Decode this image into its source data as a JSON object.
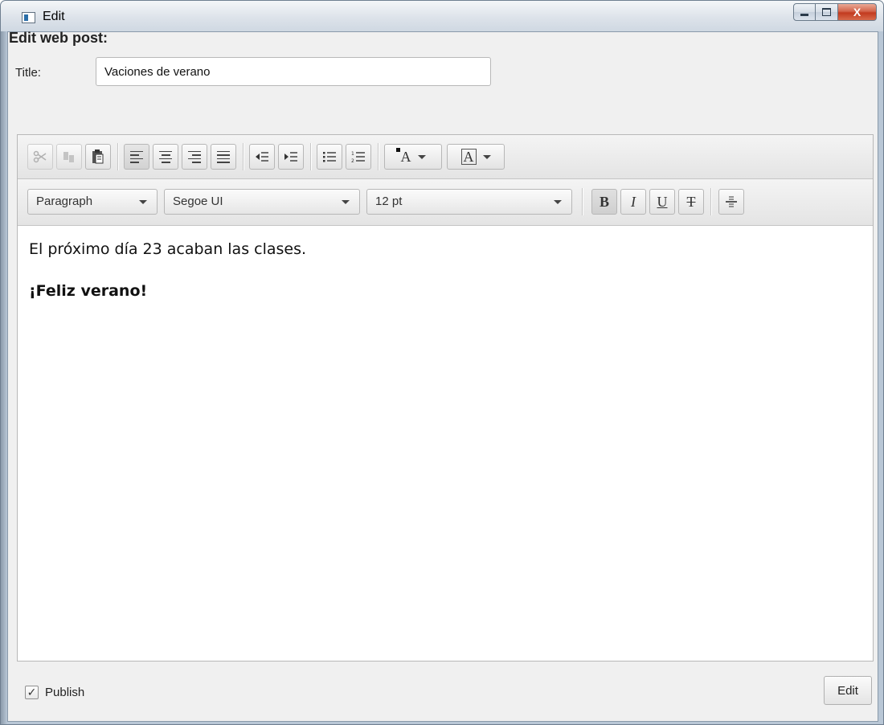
{
  "window": {
    "title": "Edit",
    "close_glyph": "X"
  },
  "form": {
    "heading": "Edit web post:",
    "title_label": "Title:",
    "title_value": "Vaciones de verano"
  },
  "toolbar": {
    "row1_icons": [
      "cut-icon",
      "copy-icon",
      "paste-icon",
      "align-left-icon",
      "align-center-icon",
      "align-right-icon",
      "align-justify-icon",
      "outdent-icon",
      "indent-icon",
      "bullet-list-icon",
      "numbered-list-icon",
      "text-color-icon",
      "background-color-icon"
    ],
    "format_select": "Paragraph",
    "font_family_select": "Segoe UI",
    "font_size_select": "12 pt",
    "bold_glyph": "B",
    "italic_glyph": "I",
    "underline_glyph": "U",
    "strike_glyph": "T",
    "text_color_glyph": "A",
    "bg_color_glyph": "A"
  },
  "content": {
    "paragraph1": "El próximo día 23 acaban las clases.",
    "paragraph2": "¡Feliz verano!"
  },
  "footer": {
    "publish_label": "Publish",
    "publish_checked": true,
    "check_glyph": "✓",
    "edit_button": "Edit"
  },
  "colors": {
    "titlebar": "#dde3ea",
    "client_bg": "#f0f0f0",
    "close_button": "#c23a1e"
  }
}
